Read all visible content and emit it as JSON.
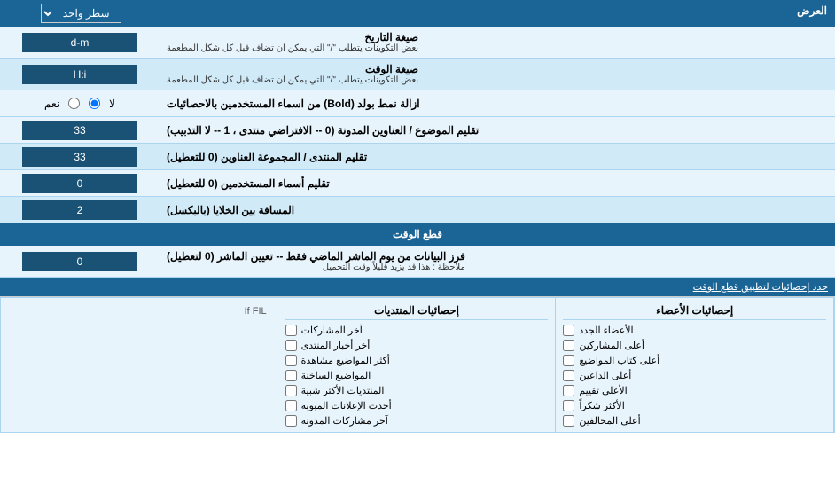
{
  "header": {
    "label_right": "العرض",
    "dropdown_label": "سطر واحد"
  },
  "rows": [
    {
      "label": "صيغة التاريخ",
      "sublabel": "بعض التكوينات يتطلب \"/\" التي يمكن ان تضاف قبل كل شكل المطعمة",
      "input_value": "d-m",
      "type": "input"
    },
    {
      "label": "صيغة الوقت",
      "sublabel": "بعض التكوينات يتطلب \"/\" التي يمكن ان تضاف قبل كل شكل المطعمة",
      "input_value": "H:i",
      "type": "input"
    },
    {
      "label": "ازالة نمط بولد (Bold) من اسماء المستخدمين بالاحصائيات",
      "sublabel": "",
      "radio_yes": "نعم",
      "radio_no": "لا",
      "selected": "no",
      "type": "radio"
    },
    {
      "label": "تقليم الموضوع / العناوين المدونة (0 -- الافتراضي منتدى ، 1 -- لا التذبيب)",
      "sublabel": "",
      "input_value": "33",
      "type": "input"
    },
    {
      "label": "تقليم المنتدى / المجموعة العناوين (0 للتعطيل)",
      "sublabel": "",
      "input_value": "33",
      "type": "input"
    },
    {
      "label": "تقليم أسماء المستخدمين (0 للتعطيل)",
      "sublabel": "",
      "input_value": "0",
      "type": "input"
    },
    {
      "label": "المسافة بين الخلايا (بالبكسل)",
      "sublabel": "",
      "input_value": "2",
      "type": "input"
    }
  ],
  "section_cutoff": {
    "title": "قطع الوقت",
    "row_label": "فرز البيانات من يوم الماشر الماضي فقط -- تعيين الماشر (0 لتعطيل)",
    "row_sublabel": "ملاحظة : هذا قد يزيد قليلاً وقت التحميل",
    "input_value": "0"
  },
  "apply_row": {
    "text": "حدد إحصائيات لتطبيق قطع الوقت"
  },
  "checkbox_cols": [
    {
      "header": "إحصائيات الأعضاء",
      "items": [
        "الأعضاء الجدد",
        "أعلى المشاركين",
        "أعلى كتاب المواضيع",
        "أعلى الداعين",
        "الأعلى تقييم",
        "الأكثر شكراً",
        "أعلى المخالفين"
      ]
    },
    {
      "header": "إحصائيات المنتديات",
      "items": [
        "آخر المشاركات",
        "أخر أخبار المنتدى",
        "أكثر المواضيع مشاهدة",
        "المواضيع الساخنة",
        "المنتديات الأكثر شبية",
        "أحدث الإعلانات المبوبة",
        "آخر مشاركات المدونة"
      ]
    },
    {
      "header": "",
      "items": []
    }
  ]
}
